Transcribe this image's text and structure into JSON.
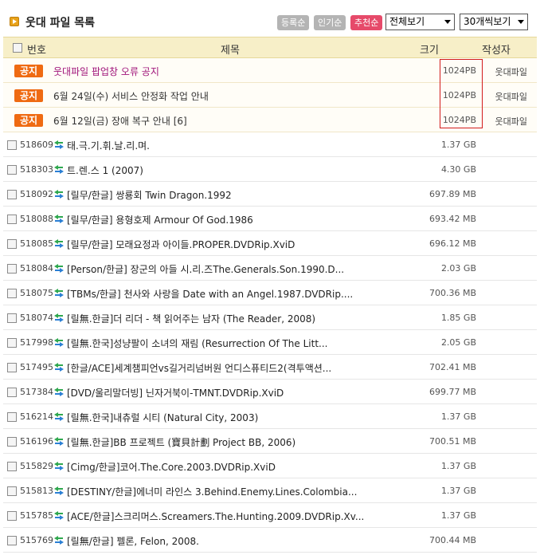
{
  "header": {
    "title": "웃대 파일 목록",
    "sort_buttons": [
      {
        "label": "등록순",
        "active": false
      },
      {
        "label": "인기순",
        "active": false
      },
      {
        "label": "추천순",
        "active": true
      }
    ],
    "filter_select": "전체보기",
    "per_page_select": "30개씩보기"
  },
  "columns": {
    "num": "번호",
    "subject": "제목",
    "size": "크기",
    "author": "작성자"
  },
  "notices": [
    {
      "badge": "공지",
      "subject": "웃대파일 팝업창 오류 공지",
      "size": "1024PB",
      "author": "웃대파일"
    },
    {
      "badge": "공지",
      "subject": "6월 24일(수) 서비스 안정화 작업 안내",
      "size": "1024PB",
      "author": "웃대파일"
    },
    {
      "badge": "공지",
      "subject": "6월 12일(금) 장애 복구 안내 [6]",
      "size": "1024PB",
      "author": "웃대파일"
    }
  ],
  "files": [
    {
      "num": "518609",
      "subject": "태.극.기.휘.날.리.며.",
      "size": "1.37 GB"
    },
    {
      "num": "518303",
      "subject": "트.렌.스 1 (2007)",
      "size": "4.30 GB"
    },
    {
      "num": "518092",
      "subject": "[릴무/한글] 쌍룡회 Twin Dragon.1992",
      "size": "697.89 MB"
    },
    {
      "num": "518088",
      "subject": "[릴무/한글] 용형호제 Armour Of God.1986",
      "size": "693.42 MB"
    },
    {
      "num": "518085",
      "subject": "[릴무/한글] 모래요정과 아이들.PROPER.DVDRip.XviD",
      "size": "696.12 MB"
    },
    {
      "num": "518084",
      "subject": "[Person/한글] 장군의 아들 시.리.즈The.Generals.Son.1990.D...",
      "size": "2.03 GB"
    },
    {
      "num": "518075",
      "subject": "[TBMs/한글] 천사와 사랑을 Date with an Angel.1987.DVDRip....",
      "size": "700.36 MB"
    },
    {
      "num": "518074",
      "subject": "[릴無.한글]더 리더 - 책 읽어주는 남자 (The Reader, 2008)",
      "size": "1.85 GB"
    },
    {
      "num": "517998",
      "subject": "[릴無.한국]성냥팔이 소녀의 재림 (Resurrection Of The Litt...",
      "size": "2.05 GB"
    },
    {
      "num": "517495",
      "subject": "[한글/ACE]세계챔피언vs길거리넘버원 언디스퓨티드2(격투액션...",
      "size": "702.41 MB"
    },
    {
      "num": "517384",
      "subject": "[DVD/울리말더빙] 닌자거북이-TMNT.DVDRip.XviD",
      "size": "699.77 MB"
    },
    {
      "num": "516214",
      "subject": "[릴無.한국]내츄럴 시티 (Natural City, 2003)",
      "size": "1.37 GB"
    },
    {
      "num": "516196",
      "subject": "[릴無.한글]BB 프로젝트 (寶貝計劃 Project BB, 2006)",
      "size": "700.51 MB"
    },
    {
      "num": "515829",
      "subject": "[Cimg/한글]코어.The.Core.2003.DVDRip.XviD",
      "size": "1.37 GB"
    },
    {
      "num": "515813",
      "subject": "[DESTINY/한글]에너미 라인스 3.Behind.Enemy.Lines.Colombia...",
      "size": "1.37 GB"
    },
    {
      "num": "515785",
      "subject": "[ACE/한글]스크리머스.Screamers.The.Hunting.2009.DVDRip.Xv...",
      "size": "1.37 GB"
    },
    {
      "num": "515769",
      "subject": "[릴無/한글] 펠론, Felon, 2008.",
      "size": "700.44 MB"
    }
  ]
}
